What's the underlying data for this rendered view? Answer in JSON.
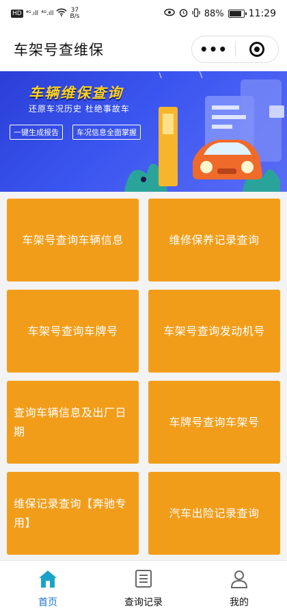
{
  "status_bar": {
    "hd": "HD",
    "signal1": "⁴ᴳ.ıll",
    "signal2": "⁴ᴳ.ıll",
    "net_speed": "37",
    "net_unit": "B/s",
    "battery": "88%",
    "battery_level": 0.88,
    "time": "11:29"
  },
  "header": {
    "title": "车架号查维保"
  },
  "banner": {
    "title": "车辆维保查询",
    "subtitle": "还原车况历史  杜绝事故车",
    "button1": "一键生成报告",
    "button2": "车况信息全面掌握"
  },
  "grid": [
    "车架号查询车辆信息",
    "维修保养记录查询",
    "车架号查询车牌号",
    "车架号查询发动机号",
    "查询车辆信息及出厂日期",
    "车牌号查询车架号",
    "维保记录查询【奔驰专用】",
    "汽车出险记录查询"
  ],
  "tabbar": {
    "home": "首页",
    "records": "查询记录",
    "mine": "我的"
  },
  "colors": {
    "card": "#f29d1a",
    "active_tab": "#1a73c9"
  }
}
